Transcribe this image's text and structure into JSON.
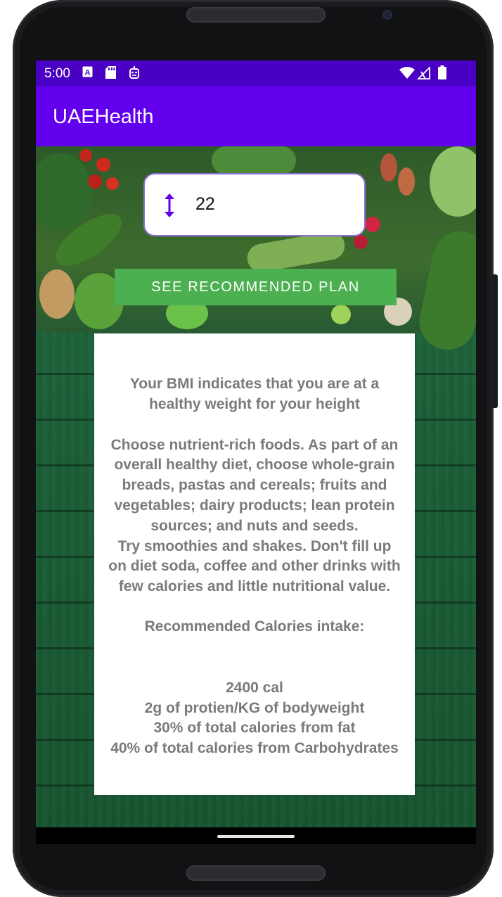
{
  "status_bar": {
    "time": "5:00",
    "left_icons": [
      "a-box-icon",
      "sd-card-icon",
      "robot-icon"
    ],
    "right_icons": [
      "wifi-icon",
      "signal-icon",
      "battery-icon"
    ]
  },
  "app_bar": {
    "title": "UAEHealth"
  },
  "bmi_input": {
    "icon": "vertical-arrows-icon",
    "value": "22"
  },
  "plan_button": {
    "label": "SEE RECOMMENDED PLAN"
  },
  "recommendation": {
    "lines": [
      "Your BMI indicates that you are at a",
      "healthy weight for your height",
      "Choose nutrient-rich foods. As part of an",
      "overall healthy diet, choose whole-grain",
      "breads, pastas and cereals; fruits and",
      "vegetables; dairy products; lean protein",
      "sources; and nuts and seeds.",
      "Try smoothies and shakes. Don't fill up",
      "on diet soda, coffee and other drinks with",
      "few calories and little nutritional value.",
      "Recommended Calories intake:",
      "2400 cal",
      "2g of protien/KG of bodyweight",
      "30% of total calories from fat",
      "40% of total calories from Carbohydrates"
    ]
  },
  "colors": {
    "status_bar": "#4a00c4",
    "app_bar": "#6200ee",
    "button": "#4caf50",
    "input_icon": "#6200ee",
    "card_text": "#7a7a7a"
  }
}
